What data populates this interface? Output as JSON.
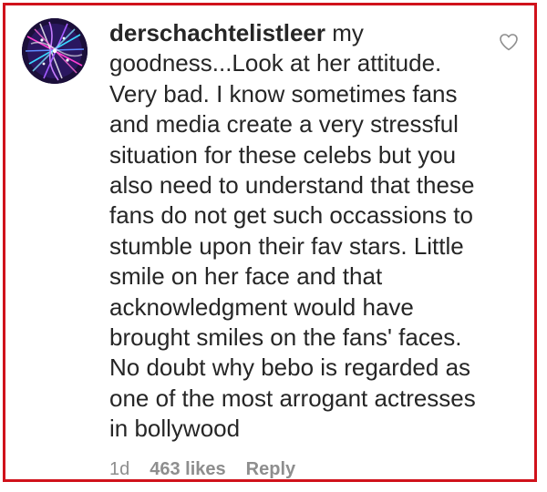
{
  "comment": {
    "username": "derschachtelistleer",
    "text": "my goodness...Look at her attitude. Very bad. I know sometimes fans and media create a very stressful situation for these celebs but you also need to understand that these fans do not get such occassions to stumble upon their fav stars. Little smile on her face and that acknowledgment would have brought smiles on the fans' faces. No doubt why bebo is regarded as one of the most arrogant actresses in bollywood"
  },
  "meta": {
    "age": "1d",
    "likes": "463 likes",
    "reply_label": "Reply"
  },
  "icons": {
    "like": "heart-outline-icon",
    "avatar": "user-avatar"
  },
  "colors": {
    "frame_border": "#d0121b",
    "text": "#262626",
    "secondary_text": "#8e8e8e"
  }
}
